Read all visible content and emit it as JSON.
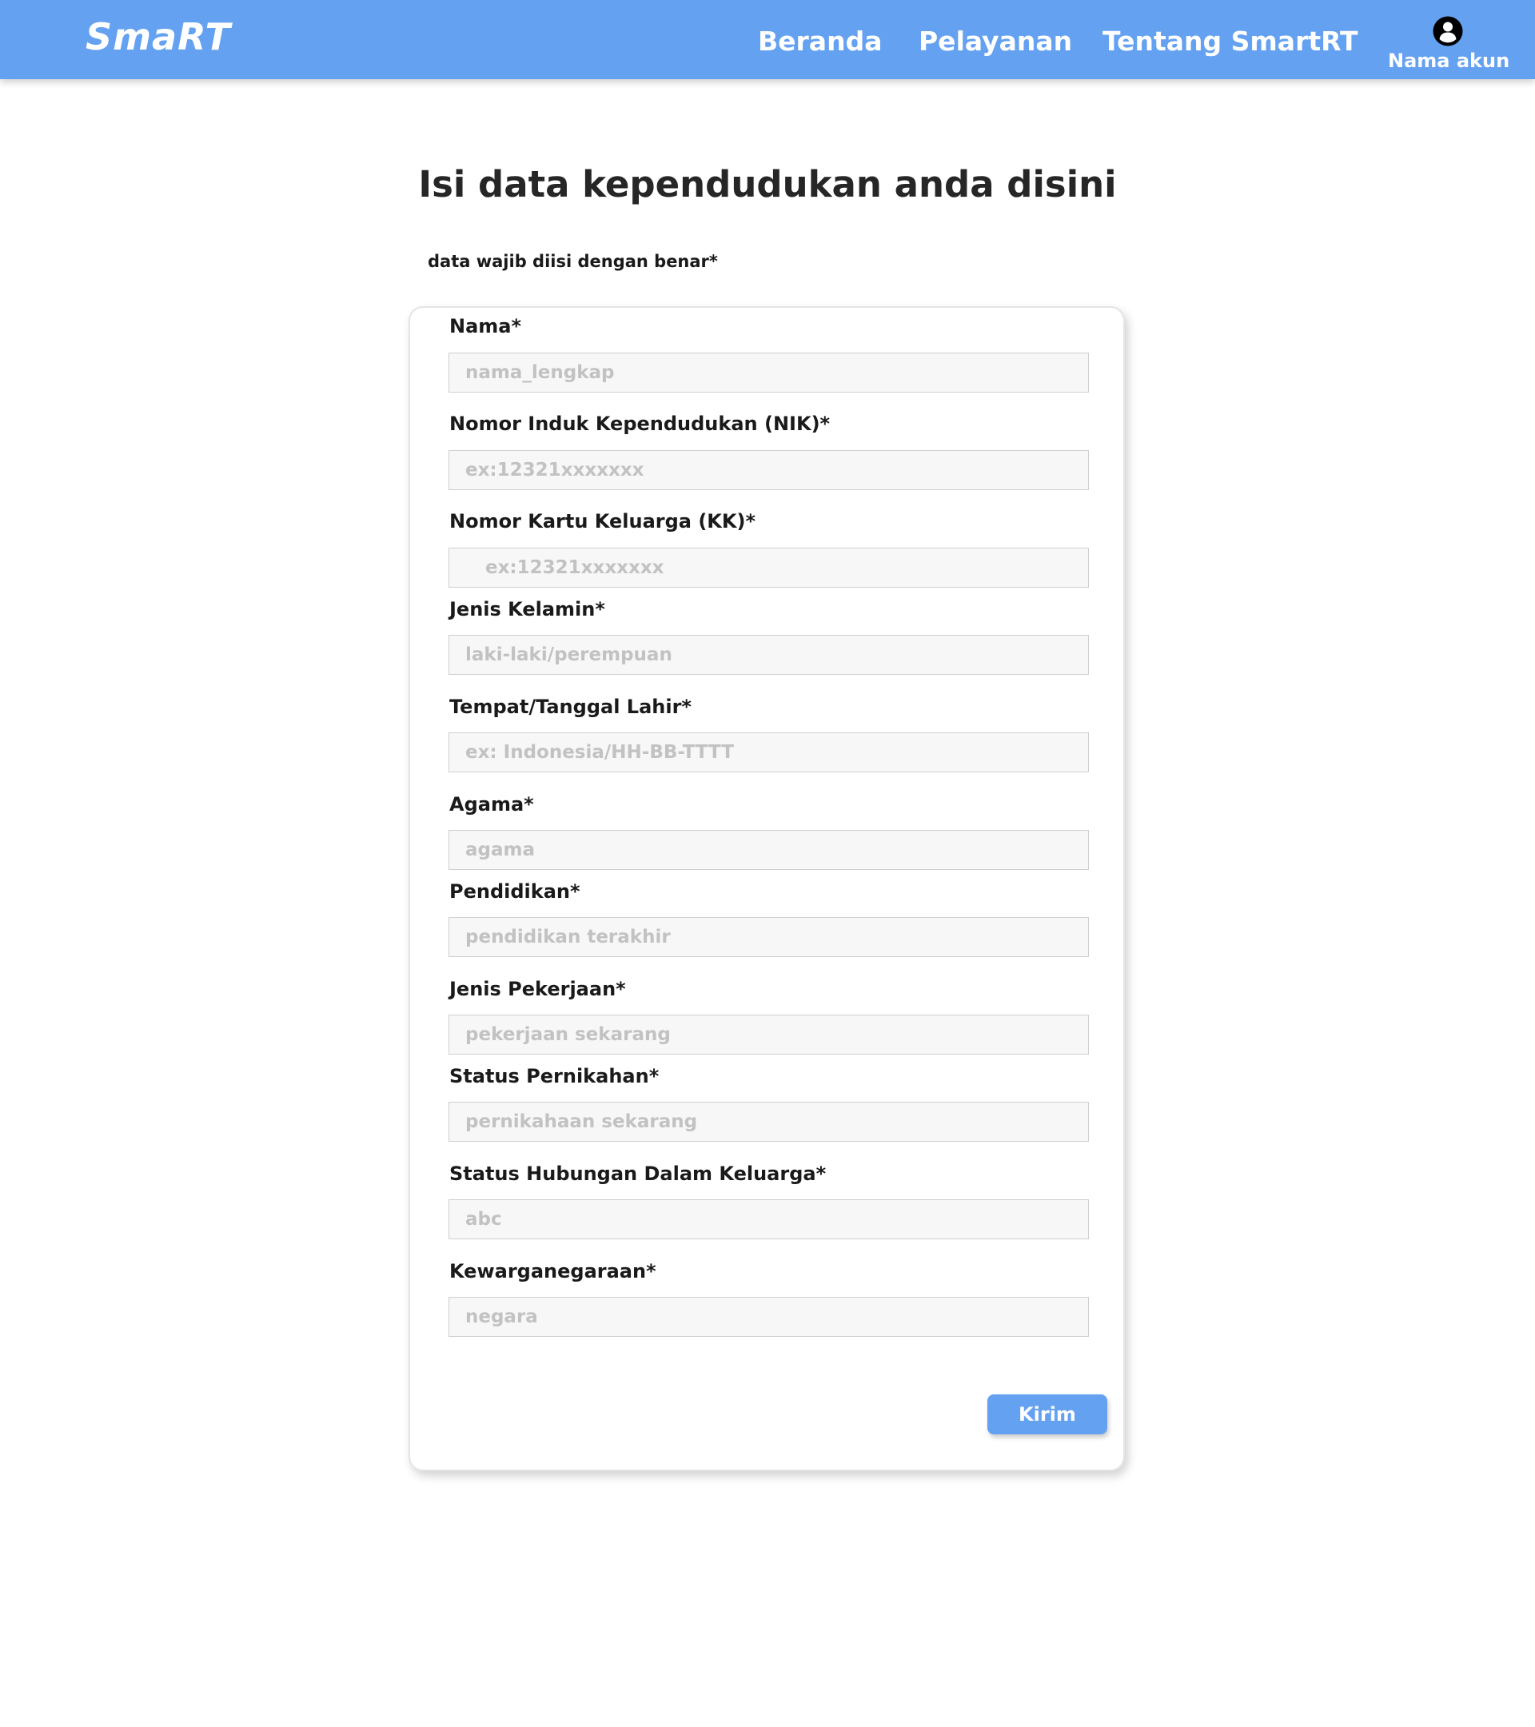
{
  "navbar": {
    "brand": "SmaRT",
    "links": [
      "Beranda",
      "Pelayanan",
      "Tentang SmartRT"
    ],
    "account_icon": "user-circle-icon",
    "account_name": "Nama akun",
    "background_color": "#64a1f1"
  },
  "page": {
    "title": "Isi data kependudukan anda disini",
    "required_note": "data wajib diisi dengan benar*"
  },
  "form": {
    "fields": [
      {
        "label": "Nama*",
        "value": "",
        "placeholder": "nama_lengkap"
      },
      {
        "label": "Nomor Induk Kependudukan (NIK)*",
        "value": "",
        "placeholder": "ex:12321xxxxxxx"
      },
      {
        "label": "Nomor Kartu Keluarga (KK)*",
        "value": "",
        "placeholder": "ex:12321xxxxxxx"
      },
      {
        "label": "Jenis Kelamin*",
        "value": "",
        "placeholder": "laki-laki/perempuan"
      },
      {
        "label": "Tempat/Tanggal Lahir*",
        "value": "",
        "placeholder": "ex: Indonesia/HH-BB-TTTT"
      },
      {
        "label": "Agama*",
        "value": "",
        "placeholder": "agama"
      },
      {
        "label": "Pendidikan*",
        "value": "",
        "placeholder": "pendidikan terakhir"
      },
      {
        "label": "Jenis Pekerjaan*",
        "value": "",
        "placeholder": "pekerjaan sekarang"
      },
      {
        "label": "Status Pernikahan*",
        "value": "",
        "placeholder": "pernikahaan sekarang"
      },
      {
        "label": "Status Hubungan Dalam Keluarga*",
        "value": "",
        "placeholder": "abc"
      },
      {
        "label": "Kewarganegaraan*",
        "value": "",
        "placeholder": "negara"
      }
    ],
    "submit_label": "Kirim"
  }
}
